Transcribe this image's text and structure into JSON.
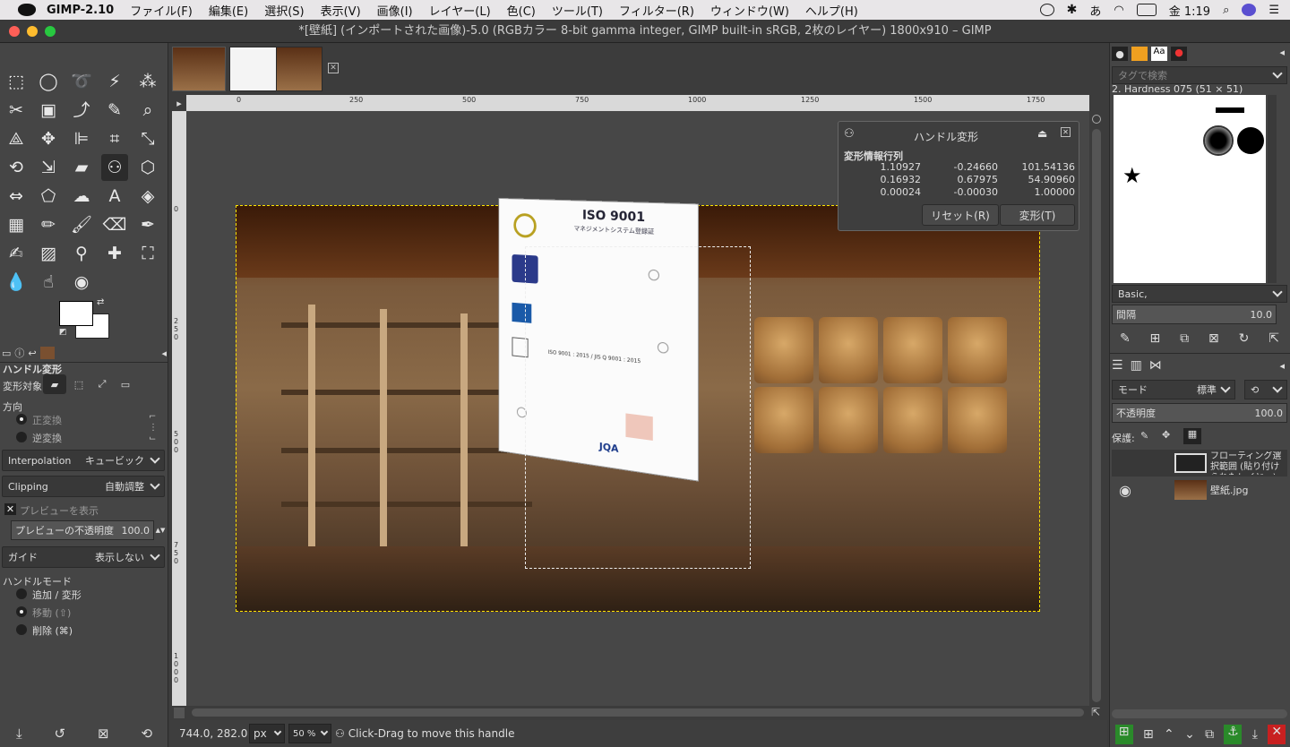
{
  "menubar": {
    "app": "GIMP-2.10",
    "items": [
      "ファイル(F)",
      "編集(E)",
      "選択(S)",
      "表示(V)",
      "画像(I)",
      "レイヤー(L)",
      "色(C)",
      "ツール(T)",
      "フィルター(R)",
      "ウィンドウ(W)",
      "ヘルプ(H)"
    ],
    "clock": "金 1:19",
    "ime": "あ"
  },
  "window": {
    "title": "*[壁紙] (インポートされた画像)-5.0 (RGBカラー 8-bit gamma integer, GIMP built-in sRGB, 2枚のレイヤー) 1800x910 – GIMP"
  },
  "tool_options": {
    "title": "ハンドル変形",
    "transform_target_label": "変形対象:",
    "direction_label": "方向",
    "direction": [
      "正変換",
      "逆変換"
    ],
    "interpolation_label": "Interpolation",
    "interpolation_value": "キュービック",
    "clipping_label": "Clipping",
    "clipping_value": "自動調整",
    "preview_label": "プレビューを表示",
    "preview_opacity_label": "プレビューの不透明度",
    "preview_opacity_value": "100.0",
    "guide_label": "ガイド",
    "guide_value": "表示しない",
    "handle_mode_label": "ハンドルモード",
    "handle_modes": [
      "追加 / 変形",
      "移動 (⇧)",
      "削除 (⌘)"
    ]
  },
  "rulers": {
    "top": [
      "0",
      "250",
      "500",
      "750",
      "1000",
      "1250",
      "1500",
      "1750"
    ],
    "left": [
      "0",
      "2 5 0",
      "5 0 0",
      "7 5 0",
      "1 0 0 0"
    ]
  },
  "dialog": {
    "title": "ハンドル変形",
    "matrix_label": "変形情報行列",
    "matrix": [
      [
        "1.10927",
        "-0.24660",
        "101.54136"
      ],
      [
        "0.16932",
        "0.67975",
        "54.90960"
      ],
      [
        "0.00024",
        "-0.00030",
        "1.00000"
      ]
    ],
    "reset_label": "リセット(R)",
    "transform_label": "変形(T)"
  },
  "document": {
    "title": "ISO 9001",
    "subtitle": "マネジメントシステム登録証",
    "standard": "ISO 9001 : 2015 / JIS Q 9001 : 2015",
    "brand": "JQA"
  },
  "statusbar": {
    "coords": "744.0, 282.0",
    "unit": "px",
    "zoom": "50 %",
    "message": "Click-Drag to move this handle"
  },
  "brushes": {
    "filter_placeholder": "タグで検索",
    "selected": "2. Hardness 075 (51 × 51)",
    "preset": "Basic,",
    "spacing_label": "間隔",
    "spacing_value": "10.0"
  },
  "layers": {
    "mode_label": "モード",
    "mode_value": "標準",
    "opacity_label": "不透明度",
    "opacity_value": "100.0",
    "lock_label": "保護:",
    "items": [
      {
        "name": "フローティング選択範囲 (貼り付けられたレイヤー)",
        "visible": false
      },
      {
        "name": "壁紙.jpg",
        "visible": true
      }
    ]
  }
}
